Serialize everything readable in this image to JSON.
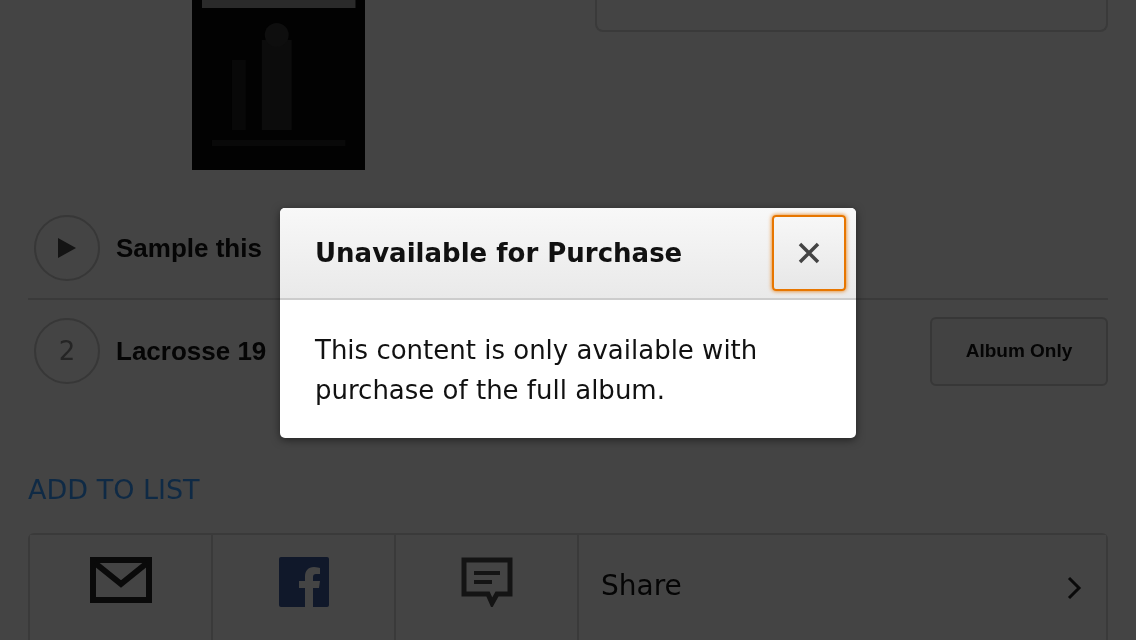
{
  "tracks": [
    {
      "kind": "sample",
      "title": "Sample this"
    },
    {
      "kind": "numbered",
      "number": "2",
      "title": "Lacrosse 19",
      "button": "Album Only"
    }
  ],
  "add_to_list": "ADD TO LIST",
  "share_bar": {
    "label": "Share"
  },
  "dialog": {
    "title": "Unavailable for Purchase",
    "message": "This content is only available with purchase of the full album.",
    "close_focused": true
  }
}
